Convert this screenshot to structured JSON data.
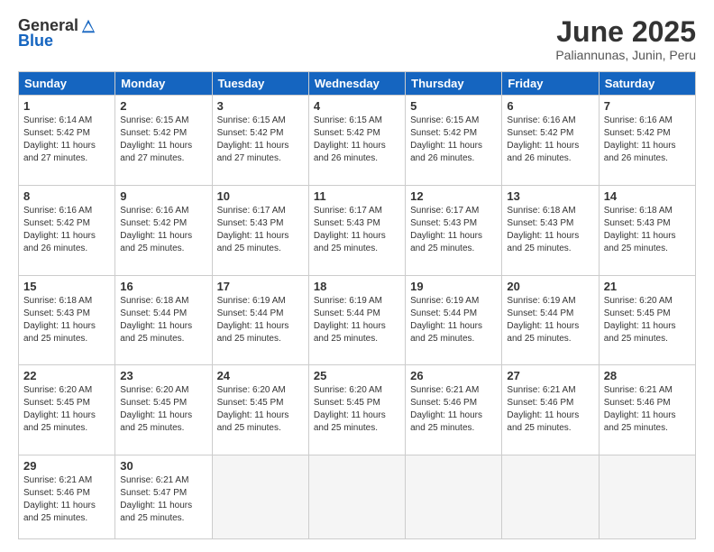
{
  "logo": {
    "general": "General",
    "blue": "Blue"
  },
  "title": "June 2025",
  "subtitle": "Paliannunas, Junin, Peru",
  "headers": [
    "Sunday",
    "Monday",
    "Tuesday",
    "Wednesday",
    "Thursday",
    "Friday",
    "Saturday"
  ],
  "weeks": [
    [
      {
        "day": "1",
        "info": "Sunrise: 6:14 AM\nSunset: 5:42 PM\nDaylight: 11 hours\nand 27 minutes."
      },
      {
        "day": "2",
        "info": "Sunrise: 6:15 AM\nSunset: 5:42 PM\nDaylight: 11 hours\nand 27 minutes."
      },
      {
        "day": "3",
        "info": "Sunrise: 6:15 AM\nSunset: 5:42 PM\nDaylight: 11 hours\nand 27 minutes."
      },
      {
        "day": "4",
        "info": "Sunrise: 6:15 AM\nSunset: 5:42 PM\nDaylight: 11 hours\nand 26 minutes."
      },
      {
        "day": "5",
        "info": "Sunrise: 6:15 AM\nSunset: 5:42 PM\nDaylight: 11 hours\nand 26 minutes."
      },
      {
        "day": "6",
        "info": "Sunrise: 6:16 AM\nSunset: 5:42 PM\nDaylight: 11 hours\nand 26 minutes."
      },
      {
        "day": "7",
        "info": "Sunrise: 6:16 AM\nSunset: 5:42 PM\nDaylight: 11 hours\nand 26 minutes."
      }
    ],
    [
      {
        "day": "8",
        "info": "Sunrise: 6:16 AM\nSunset: 5:42 PM\nDaylight: 11 hours\nand 26 minutes."
      },
      {
        "day": "9",
        "info": "Sunrise: 6:16 AM\nSunset: 5:42 PM\nDaylight: 11 hours\nand 25 minutes."
      },
      {
        "day": "10",
        "info": "Sunrise: 6:17 AM\nSunset: 5:43 PM\nDaylight: 11 hours\nand 25 minutes."
      },
      {
        "day": "11",
        "info": "Sunrise: 6:17 AM\nSunset: 5:43 PM\nDaylight: 11 hours\nand 25 minutes."
      },
      {
        "day": "12",
        "info": "Sunrise: 6:17 AM\nSunset: 5:43 PM\nDaylight: 11 hours\nand 25 minutes."
      },
      {
        "day": "13",
        "info": "Sunrise: 6:18 AM\nSunset: 5:43 PM\nDaylight: 11 hours\nand 25 minutes."
      },
      {
        "day": "14",
        "info": "Sunrise: 6:18 AM\nSunset: 5:43 PM\nDaylight: 11 hours\nand 25 minutes."
      }
    ],
    [
      {
        "day": "15",
        "info": "Sunrise: 6:18 AM\nSunset: 5:43 PM\nDaylight: 11 hours\nand 25 minutes."
      },
      {
        "day": "16",
        "info": "Sunrise: 6:18 AM\nSunset: 5:44 PM\nDaylight: 11 hours\nand 25 minutes."
      },
      {
        "day": "17",
        "info": "Sunrise: 6:19 AM\nSunset: 5:44 PM\nDaylight: 11 hours\nand 25 minutes."
      },
      {
        "day": "18",
        "info": "Sunrise: 6:19 AM\nSunset: 5:44 PM\nDaylight: 11 hours\nand 25 minutes."
      },
      {
        "day": "19",
        "info": "Sunrise: 6:19 AM\nSunset: 5:44 PM\nDaylight: 11 hours\nand 25 minutes."
      },
      {
        "day": "20",
        "info": "Sunrise: 6:19 AM\nSunset: 5:44 PM\nDaylight: 11 hours\nand 25 minutes."
      },
      {
        "day": "21",
        "info": "Sunrise: 6:20 AM\nSunset: 5:45 PM\nDaylight: 11 hours\nand 25 minutes."
      }
    ],
    [
      {
        "day": "22",
        "info": "Sunrise: 6:20 AM\nSunset: 5:45 PM\nDaylight: 11 hours\nand 25 minutes."
      },
      {
        "day": "23",
        "info": "Sunrise: 6:20 AM\nSunset: 5:45 PM\nDaylight: 11 hours\nand 25 minutes."
      },
      {
        "day": "24",
        "info": "Sunrise: 6:20 AM\nSunset: 5:45 PM\nDaylight: 11 hours\nand 25 minutes."
      },
      {
        "day": "25",
        "info": "Sunrise: 6:20 AM\nSunset: 5:45 PM\nDaylight: 11 hours\nand 25 minutes."
      },
      {
        "day": "26",
        "info": "Sunrise: 6:21 AM\nSunset: 5:46 PM\nDaylight: 11 hours\nand 25 minutes."
      },
      {
        "day": "27",
        "info": "Sunrise: 6:21 AM\nSunset: 5:46 PM\nDaylight: 11 hours\nand 25 minutes."
      },
      {
        "day": "28",
        "info": "Sunrise: 6:21 AM\nSunset: 5:46 PM\nDaylight: 11 hours\nand 25 minutes."
      }
    ],
    [
      {
        "day": "29",
        "info": "Sunrise: 6:21 AM\nSunset: 5:46 PM\nDaylight: 11 hours\nand 25 minutes."
      },
      {
        "day": "30",
        "info": "Sunrise: 6:21 AM\nSunset: 5:47 PM\nDaylight: 11 hours\nand 25 minutes."
      },
      {
        "day": "",
        "info": ""
      },
      {
        "day": "",
        "info": ""
      },
      {
        "day": "",
        "info": ""
      },
      {
        "day": "",
        "info": ""
      },
      {
        "day": "",
        "info": ""
      }
    ]
  ]
}
